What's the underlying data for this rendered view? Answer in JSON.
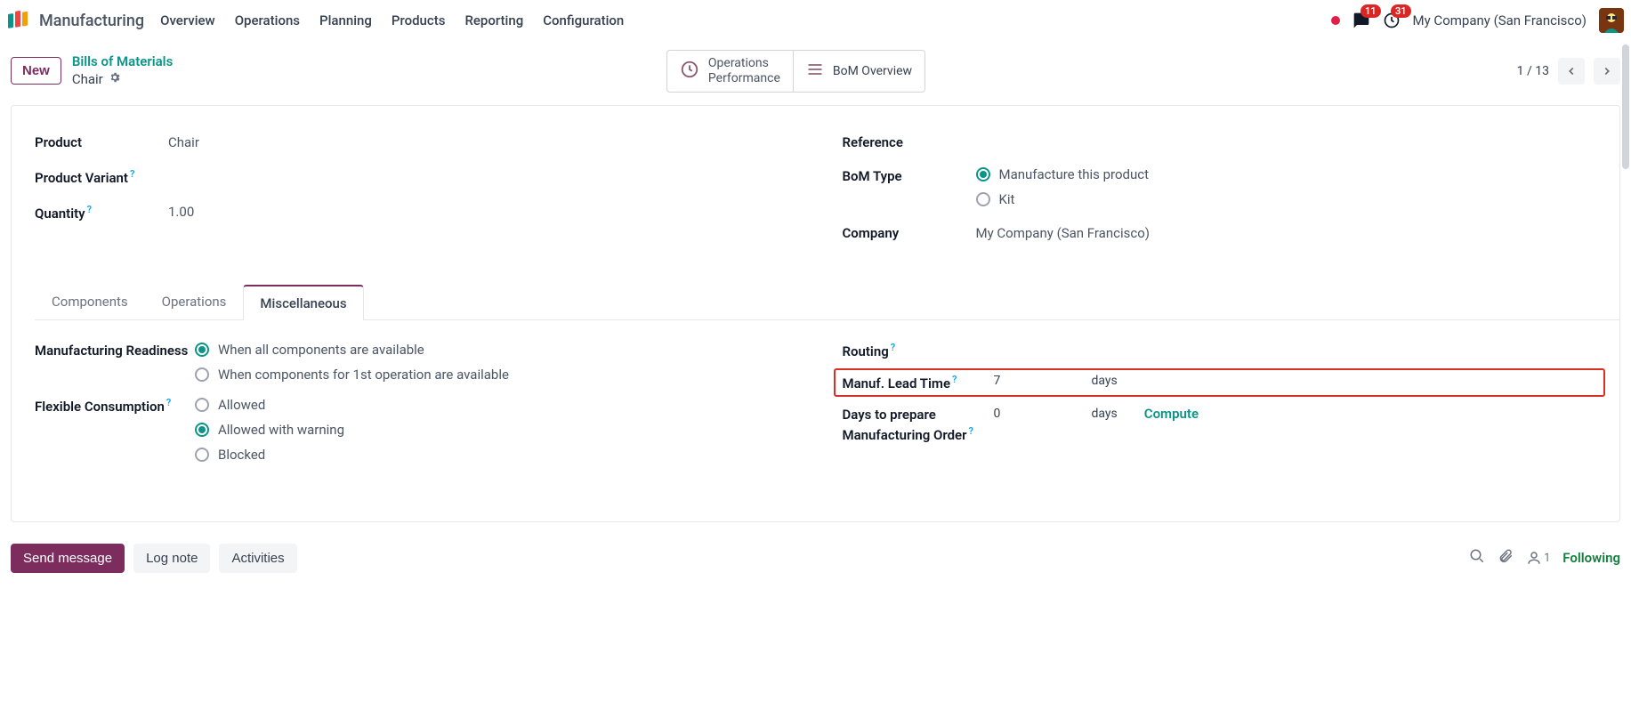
{
  "topnav": {
    "app_title": "Manufacturing",
    "items": [
      "Overview",
      "Operations",
      "Planning",
      "Products",
      "Reporting",
      "Configuration"
    ],
    "msg_badge": "11",
    "act_badge": "31",
    "company": "My Company (San Francisco)"
  },
  "actionbar": {
    "new_label": "New",
    "breadcrumb_link": "Bills of Materials",
    "breadcrumb_current": "Chair",
    "stat_ops_line1": "Operations",
    "stat_ops_line2": "Performance",
    "stat_bom": "BoM Overview",
    "pager": "1 / 13"
  },
  "form": {
    "left": {
      "product_label": "Product",
      "product_value": "Chair",
      "variant_label": "Product Variant",
      "quantity_label": "Quantity",
      "quantity_value": "1.00"
    },
    "right": {
      "reference_label": "Reference",
      "bom_type_label": "BoM Type",
      "bom_type_options": [
        "Manufacture this product",
        "Kit"
      ],
      "company_label": "Company",
      "company_value": "My Company (San Francisco)"
    }
  },
  "tabs": [
    "Components",
    "Operations",
    "Miscellaneous"
  ],
  "misc": {
    "left": {
      "readiness_label": "Manufacturing Readiness",
      "readiness_options": [
        "When all components are available",
        "When components for 1st operation are available"
      ],
      "flex_label": "Flexible Consumption",
      "flex_options": [
        "Allowed",
        "Allowed with warning",
        "Blocked"
      ]
    },
    "right": {
      "routing_label": "Routing",
      "lead_label": "Manuf. Lead Time",
      "lead_value": "7",
      "lead_unit": "days",
      "prep_label": "Days to prepare Manufacturing Order",
      "prep_value": "0",
      "prep_unit": "days",
      "compute": "Compute"
    }
  },
  "chatter": {
    "send": "Send message",
    "log": "Log note",
    "activities": "Activities",
    "follow_count": "1",
    "following": "Following"
  }
}
